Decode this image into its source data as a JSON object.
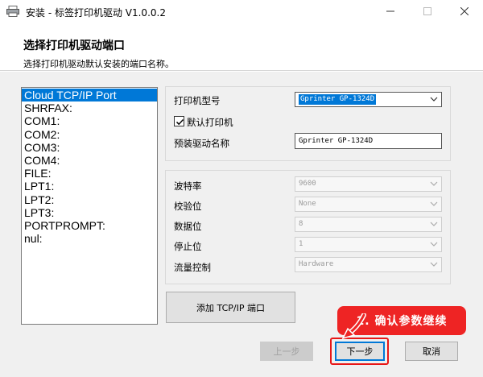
{
  "window": {
    "title": "安装 - 标签打印机驱动 V1.0.0.2"
  },
  "header": {
    "title": "选择打印机驱动端口",
    "subtitle": "选择打印机驱动默认安装的端口名称。"
  },
  "ports": [
    {
      "label": "Cloud TCP/IP Port",
      "selected": true
    },
    {
      "label": "SHRFAX:"
    },
    {
      "label": "COM1:"
    },
    {
      "label": "COM2:"
    },
    {
      "label": "COM3:"
    },
    {
      "label": "COM4:"
    },
    {
      "label": "FILE:"
    },
    {
      "label": "LPT1:"
    },
    {
      "label": "LPT2:"
    },
    {
      "label": "LPT3:"
    },
    {
      "label": "PORTPROMPT:"
    },
    {
      "label": "nul:"
    }
  ],
  "printer": {
    "model_label": "打印机型号",
    "model_value": "Gprinter GP-1324D",
    "default_label": "默认打印机",
    "default_checked": true,
    "driver_name_label": "预装驱动名称",
    "driver_name_value": "Gprinter GP-1324D"
  },
  "serial": {
    "baud_label": "波特率",
    "baud_value": "9600",
    "parity_label": "校验位",
    "parity_value": "None",
    "data_bits_label": "数据位",
    "data_bits_value": "8",
    "stop_bits_label": "停止位",
    "stop_bits_value": "1",
    "flow_label": "流量控制",
    "flow_value": "Hardware"
  },
  "buttons": {
    "add_tcp": "添加 TCP/IP 端口",
    "prev": "上一步",
    "next": "下一步",
    "cancel": "取消"
  },
  "annotation": {
    "text": "1. 确认参数继续"
  },
  "colors": {
    "accent": "#0078d7",
    "annotation": "#ee2424"
  }
}
